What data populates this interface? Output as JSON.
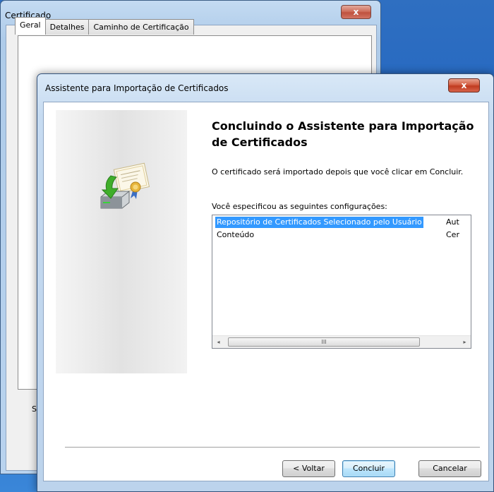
{
  "background_window": {
    "title": "Certificado",
    "close_label": "x",
    "tabs": [
      "Geral",
      "Detalhes",
      "Caminho de Certificação"
    ],
    "partial_text": "S"
  },
  "wizard": {
    "title": "Assistente para Importação de Certificados",
    "close_label": "x",
    "heading": "Concluindo o Assistente para Importação de Certificados",
    "description": "O certificado será importado depois que você clicar em Concluir.",
    "settings_label": "Você especificou as seguintes configurações:",
    "settings_rows": [
      {
        "name": "Repositório de Certificados Selecionado pelo Usuário",
        "value": "Aut",
        "selected": true
      },
      {
        "name": "Conteúdo",
        "value": "Cer",
        "selected": false
      }
    ],
    "scrollbar": {
      "left_arrow": "◂",
      "right_arrow": "▸",
      "grip": "III"
    },
    "buttons": {
      "back": "< Voltar",
      "finish": "Concluir",
      "cancel": "Cancelar"
    }
  },
  "colors": {
    "selection": "#3399ff",
    "close_button": "#c03b20",
    "desktop": "#1e63c2"
  },
  "icons": [
    "certificate-import-icon",
    "close-icon",
    "scroll-left-icon",
    "scroll-right-icon"
  ]
}
